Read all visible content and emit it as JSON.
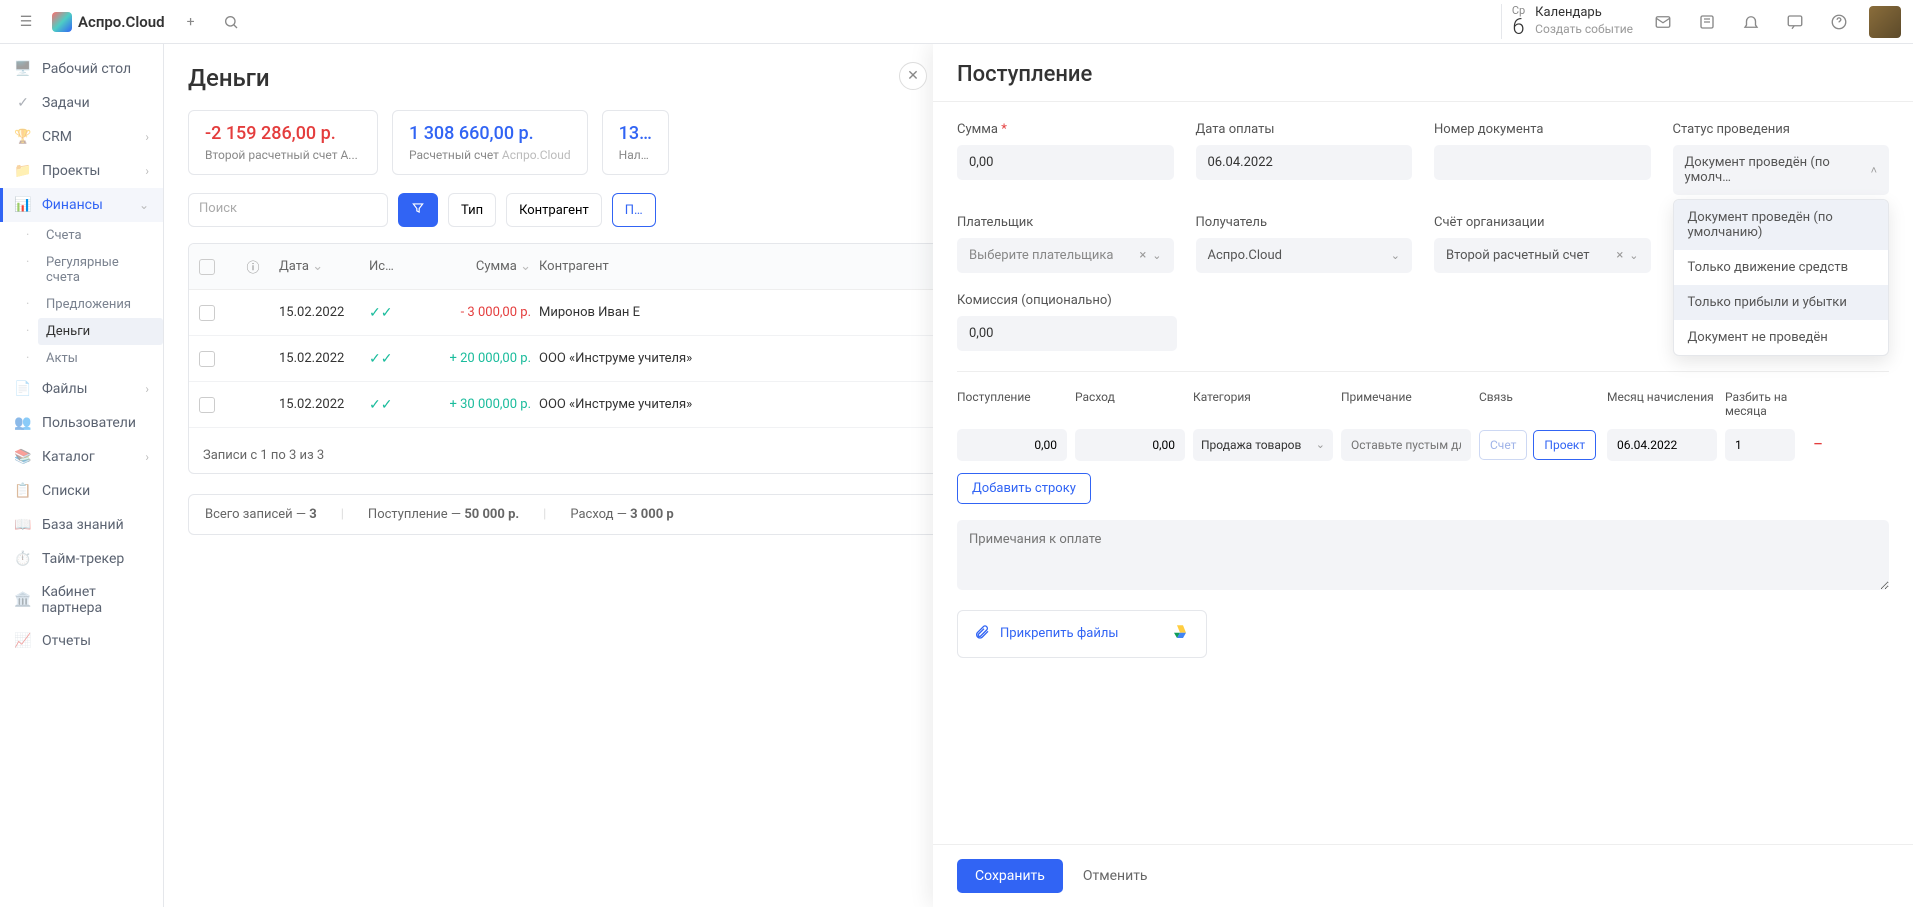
{
  "app": {
    "name": "Аспро.Cloud"
  },
  "header": {
    "calendar": {
      "dayName": "Ср",
      "dayNum": "6",
      "title": "Календарь",
      "subtitle": "Создать событие"
    }
  },
  "sidebar": {
    "items": [
      {
        "label": "Рабочий стол"
      },
      {
        "label": "Задачи"
      },
      {
        "label": "CRM"
      },
      {
        "label": "Проекты"
      },
      {
        "label": "Финансы"
      },
      {
        "label": "Файлы"
      },
      {
        "label": "Пользователи"
      },
      {
        "label": "Каталог"
      },
      {
        "label": "Списки"
      },
      {
        "label": "База знаний"
      },
      {
        "label": "Тайм-трекер"
      },
      {
        "label": "Кабинет партнера"
      },
      {
        "label": "Отчеты"
      }
    ],
    "finance_sub": [
      {
        "label": "Счета"
      },
      {
        "label": "Регулярные счета"
      },
      {
        "label": "Предложения"
      },
      {
        "label": "Деньги"
      },
      {
        "label": "Акты"
      }
    ]
  },
  "page": {
    "title": "Деньги",
    "cards": [
      {
        "value": "-2 159 286,00 р.",
        "sub": "Второй расчетный счет А..."
      },
      {
        "value": "1 308 660,00 р.",
        "sub": "Расчетный счет",
        "sub_tag": "Аспро.Cloud"
      },
      {
        "value": "13…",
        "sub": "Нал…"
      }
    ],
    "search_placeholder": "Поиск",
    "filters": {
      "type": "Тип",
      "counterparty": "Контрагент",
      "period": "П…"
    },
    "table": {
      "headers": {
        "date": "Дата",
        "source": "Ис…",
        "amount": "Сумма",
        "counterparty": "Контрагент"
      },
      "rows": [
        {
          "date": "15.02.2022",
          "amount": "- 3 000,00 р.",
          "neg": true,
          "counterparty": "Миронов Иван Е"
        },
        {
          "date": "15.02.2022",
          "amount": "+ 20 000,00 р.",
          "neg": false,
          "counterparty": "ООО «Инструме учителя»"
        },
        {
          "date": "15.02.2022",
          "amount": "+ 30 000,00 р.",
          "neg": false,
          "counterparty": "ООО «Инструме учителя»"
        }
      ],
      "counter": "Записи с 1 по 3 из 3"
    },
    "footer": {
      "total_label": "Всего записей —",
      "total_value": "3",
      "income_label": "Поступление —",
      "income_value": "50 000 р.",
      "expense_label": "Расход —",
      "expense_value": "3 000 р"
    }
  },
  "panel": {
    "title": "Поступление",
    "labels": {
      "amount": "Сумма",
      "payment_date": "Дата оплаты",
      "doc_number": "Номер документа",
      "status": "Статус проведения",
      "payer": "Плательщик",
      "receiver": "Получатель",
      "org_account": "Счёт организации",
      "commission": "Комиссия (опционально)"
    },
    "values": {
      "amount": "0,00",
      "payment_date": "06.04.2022",
      "doc_number": "",
      "status_selected": "Документ проведён (по умолч…",
      "payer_placeholder": "Выберите плательщика",
      "receiver": "Аспро.Cloud",
      "org_account": "Второй расчетный счет",
      "commission": "0,00"
    },
    "status_options": [
      "Документ проведён (по умолчанию)",
      "Только движение средств",
      "Только прибыли и убытки",
      "Документ не проведён"
    ],
    "split": {
      "headers": {
        "income": "Поступление",
        "expense": "Расход",
        "category": "Категория",
        "note": "Примечание",
        "link": "Связь",
        "accrual_month": "Месяц начисления",
        "split_months": "Разбить на месяца"
      },
      "row": {
        "income": "0,00",
        "expense": "0,00",
        "category": "Продажа товаров",
        "note_placeholder": "Оставьте пустым дл",
        "link_invoice": "Счет",
        "link_project": "Проект",
        "accrual_month": "06.04.2022",
        "split_months": "1"
      },
      "add_row": "Добавить строку"
    },
    "notes_placeholder": "Примечания к оплате",
    "attach": "Прикрепить файлы",
    "actions": {
      "save": "Сохранить",
      "cancel": "Отменить"
    }
  }
}
